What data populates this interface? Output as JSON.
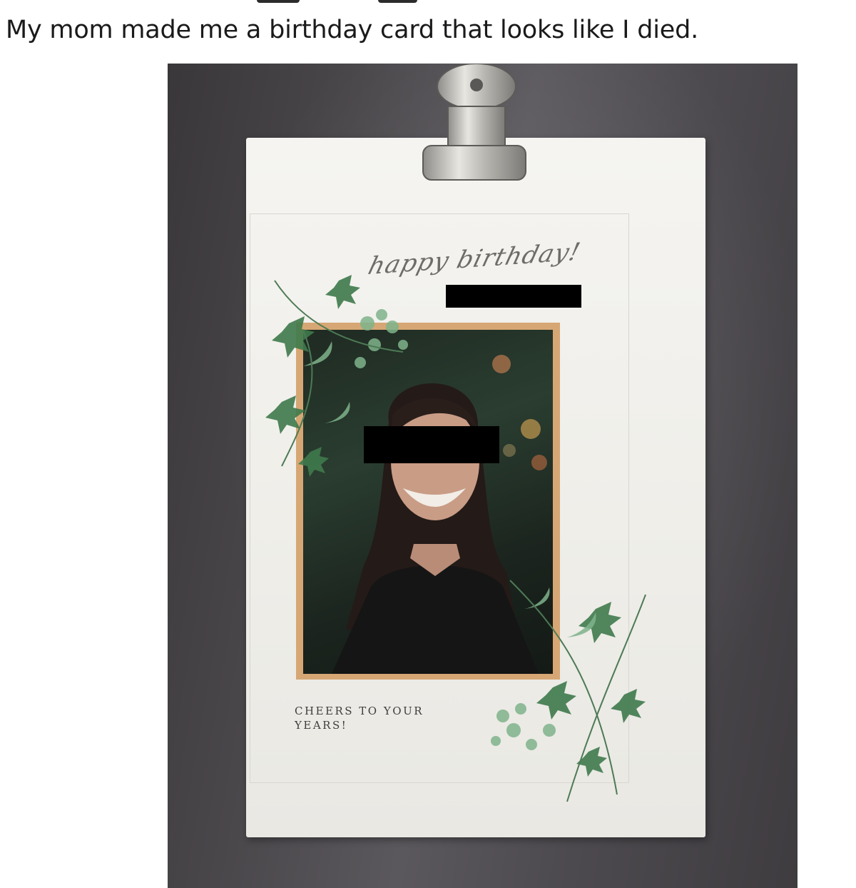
{
  "post": {
    "title": "My mom made me a birthday card that looks like I died."
  },
  "card": {
    "greeting": "happy birthday!",
    "message_line1": "CHEERS TO YOUR",
    "message_line2": "YEARS!",
    "frame_color": "#d6a774",
    "paper_color": "#f2f1ec"
  },
  "icons": [
    "binder-clip-icon",
    "ivy-leaves-icon"
  ]
}
